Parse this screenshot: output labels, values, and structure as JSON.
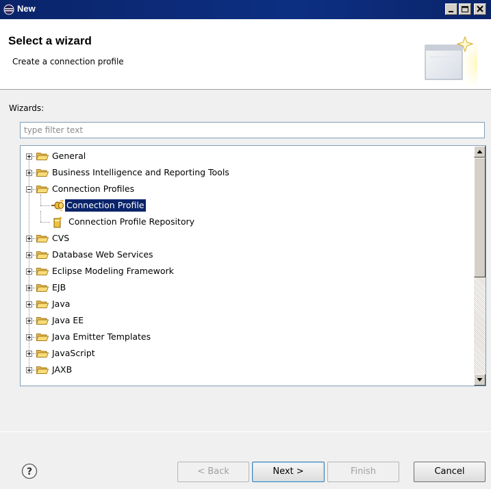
{
  "window": {
    "title": "New"
  },
  "header": {
    "title": "Select a wizard",
    "description": "Create a connection profile"
  },
  "wizards_label": "Wizards:",
  "filter": {
    "placeholder": "type filter text",
    "value": ""
  },
  "tree": {
    "items": [
      {
        "label": "General",
        "level": 0,
        "kind": "folder",
        "expanded": false
      },
      {
        "label": "Business Intelligence and Reporting Tools",
        "level": 0,
        "kind": "folder",
        "expanded": false
      },
      {
        "label": "Connection Profiles",
        "level": 0,
        "kind": "folder",
        "expanded": true
      },
      {
        "label": "Connection Profile",
        "level": 1,
        "kind": "connection-profile-icon",
        "selected": true
      },
      {
        "label": "Connection Profile Repository",
        "level": 1,
        "kind": "repository-icon"
      },
      {
        "label": "CVS",
        "level": 0,
        "kind": "folder",
        "expanded": false
      },
      {
        "label": "Database Web Services",
        "level": 0,
        "kind": "folder",
        "expanded": false
      },
      {
        "label": "Eclipse Modeling Framework",
        "level": 0,
        "kind": "folder",
        "expanded": false
      },
      {
        "label": "EJB",
        "level": 0,
        "kind": "folder",
        "expanded": false
      },
      {
        "label": "Java",
        "level": 0,
        "kind": "folder",
        "expanded": false
      },
      {
        "label": "Java EE",
        "level": 0,
        "kind": "folder",
        "expanded": false
      },
      {
        "label": "Java Emitter Templates",
        "level": 0,
        "kind": "folder",
        "expanded": false
      },
      {
        "label": "JavaScript",
        "level": 0,
        "kind": "folder",
        "expanded": false
      },
      {
        "label": "JAXB",
        "level": 0,
        "kind": "folder",
        "expanded": false
      }
    ]
  },
  "buttons": {
    "back": "< Back",
    "next": "Next >",
    "finish": "Finish",
    "cancel": "Cancel"
  },
  "colors": {
    "titlebar": "#0a246a",
    "selection": "#0a246a",
    "folder": "#f3d35e"
  }
}
